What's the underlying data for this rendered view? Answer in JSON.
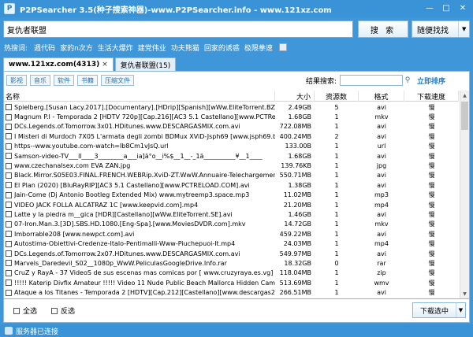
{
  "window": {
    "title": "P2PSearcher 3.5(种子搜索神器)-www.P2PSearcher.info - www.121xz.com"
  },
  "search": {
    "value": "复仇者联盟",
    "button": "搜 索",
    "random_button": "随便找找"
  },
  "hot": {
    "label": "热搜词:",
    "items": [
      "週代码",
      "家的n次方",
      "生活大爆炸",
      "建党伟业",
      "功夫熊猫",
      "回家的诱惑",
      "极限拳速"
    ]
  },
  "tabs": [
    {
      "label": "www.121xz.com(4313)",
      "close": "×"
    },
    {
      "label": "复仇者联盟(15)",
      "close": ""
    }
  ],
  "filters": [
    "影视",
    "音乐",
    "软件",
    "书籍",
    "压缩文件"
  ],
  "result_search": {
    "label": "结果搜索:",
    "sort": "立即排序"
  },
  "table": {
    "columns": [
      "名称",
      "大小",
      "资源数",
      "格式",
      "下载速度"
    ],
    "rows": [
      {
        "name": "Spielberg.[Susan Lacy.2017].[Documentary].[HDrip][Spanish][wWw.EliteTorrent.BZ].avi",
        "size": "2.49GB",
        "files": "5",
        "format": "avi",
        "speed": "慢"
      },
      {
        "name": "Magnum P.I - Temporada 2 [HDTV 720p][Cap.216][AC3 5.1 Castellano][www.PCTReload.COM...",
        "size": "1.68GB",
        "files": "1",
        "format": "mkv",
        "speed": "慢"
      },
      {
        "name": "DCs.Legends.of.Tomorrow.3x01.HDitunes.www.DESCARGASMIX.com.avi",
        "size": "722.08MB",
        "files": "1",
        "format": "avi",
        "speed": "慢"
      },
      {
        "name": "I Misteri di Murdoch 7X05 L'armata degli zombi BDMux XViD-Jsph69 [www.jsph69.blogspot.it]...",
        "size": "400.24MB",
        "files": "2",
        "format": "avi",
        "speed": "慢"
      },
      {
        "name": "https--www.youtube.com-watch=Ib8Cm1vJsQ.url",
        "size": "133.00B",
        "files": "1",
        "format": "url",
        "speed": "慢"
      },
      {
        "name": "Samson-video-TV___ll____3________a___ia]ä°o__i%$__1__-_1ä__________¥__1____",
        "size": "1.68GB",
        "files": "1",
        "format": "avi",
        "speed": "慢"
      },
      {
        "name": "www.czechanalsex.com EVA ZAN.jpg",
        "size": "139.76KB",
        "files": "1",
        "format": "jpg",
        "speed": "慢"
      },
      {
        "name": "Black.Mirror.S05E03.FINAL.FRENCH.WEBRip.XviD-ZT.WwW.Annuaire-Telechargement.Co...",
        "size": "550.71MB",
        "files": "1",
        "format": "avi",
        "speed": "慢"
      },
      {
        "name": "El Plan (2020) [BluRayRIP][AC3 5.1 Castellano][www.PCTRELOAD.COM].avi",
        "size": "1.38GB",
        "files": "1",
        "format": "avi",
        "speed": "慢"
      },
      {
        "name": "Jain-Come (Dj Antonio Bootleg Extended Mix) www.mytreemp3.space.mp3",
        "size": "11.02MB",
        "files": "1",
        "format": "mp3",
        "speed": "慢"
      },
      {
        "name": "VIDEO JACK FOLLA ALCATRAZ 1C [www.keepvid.com].mp4",
        "size": "21.20MB",
        "files": "1",
        "format": "mp4",
        "speed": "慢"
      },
      {
        "name": "Latte y la piedra m__gica [HDR][Castellano][wWw.EliteTorrent.SE].avi",
        "size": "1.46GB",
        "files": "1",
        "format": "avi",
        "speed": "慢"
      },
      {
        "name": "07-Iron.Man.3.[3D].SBS.HD.1080.[Eng-Spa].[www.MoviesDVDR.com].mkv",
        "size": "14.72GB",
        "files": "1",
        "format": "mkv",
        "speed": "慢"
      },
      {
        "name": "Imborrable208 [www.newpct.com].avi",
        "size": "459.22MB",
        "files": "1",
        "format": "avi",
        "speed": "慢"
      },
      {
        "name": "Autostima-Obiettivi-Credenze-Italo-Pentimalli-Www-Piuchepuoi-It.mp4",
        "size": "24.03MB",
        "files": "1",
        "format": "mp4",
        "speed": "慢"
      },
      {
        "name": "DCs.Legends.of.Tomorrow.2x07.HDitunes.www.DESCARGASMIX.com.avi",
        "size": "549.97MB",
        "files": "1",
        "format": "avi",
        "speed": "慢"
      },
      {
        "name": "Marvels_Daredevil_S02__1080p_WwW.PeliculasGoogleDrive.Info.rar",
        "size": "18.32GB",
        "files": "0",
        "format": "rar",
        "speed": "慢"
      },
      {
        "name": "CruZ y RayA - 37 VideoS de sus escenas mas comicas por [ www.cruzyraya.es.vg] Compartid...",
        "size": "118.04MB",
        "files": "1",
        "format": "zip",
        "speed": "慢"
      },
      {
        "name": "!!!!! Katerip Divfix Amateur !!!!! Video 11 Nude Public Beach Mallorca Hidden Camera Www Sa...",
        "size": "513.69MB",
        "files": "1",
        "format": "wmv",
        "speed": "慢"
      },
      {
        "name": "Ataque a los Titanes - Temporada 2 [HDTV][Cap.212][Castellano][www.descargas2020.org].avi",
        "size": "266.51MB",
        "files": "1",
        "format": "avi",
        "speed": "慢"
      }
    ]
  },
  "bottom": {
    "select_all": "全选",
    "invert": "反选",
    "download": "下载选中"
  },
  "status": {
    "text": "服务器已连接"
  }
}
